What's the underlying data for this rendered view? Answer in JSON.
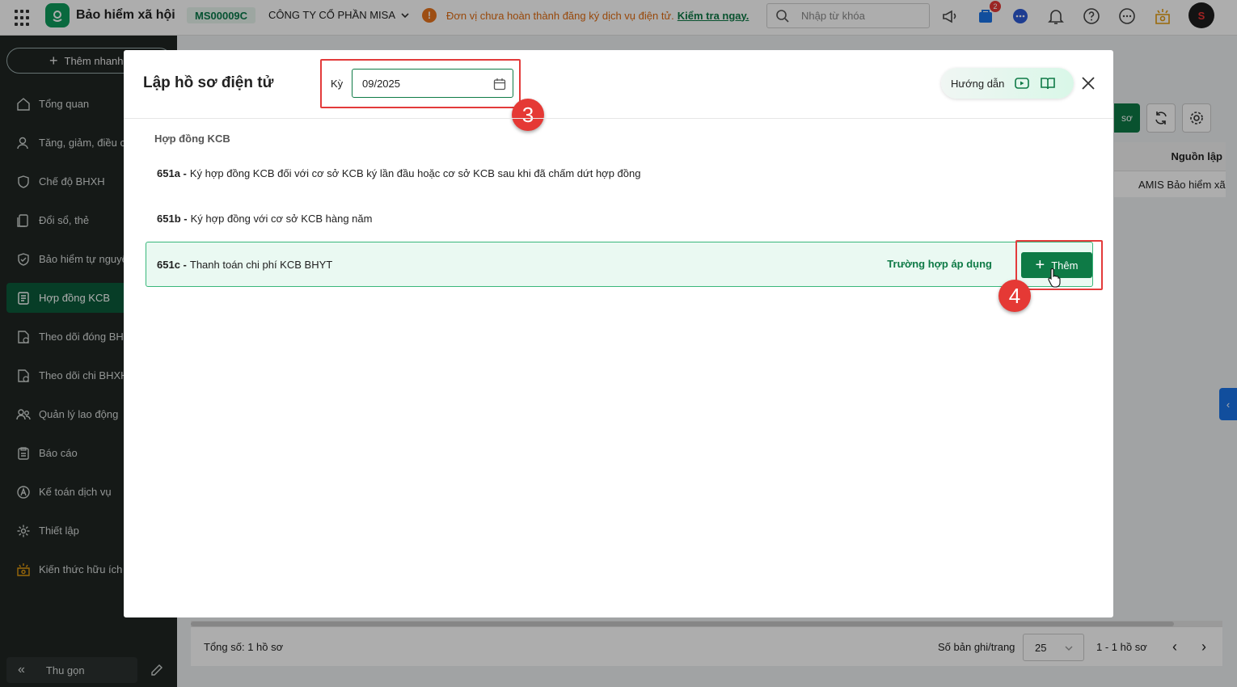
{
  "topbar": {
    "app_name": "Bảo hiểm xã hội",
    "company_code": "MS00009C",
    "company_name": "CÔNG TY CỔ PHẦN MISA",
    "warning_text": "Đơn vị chưa hoàn thành đăng ký dịch vụ điện tử.",
    "warning_link": "Kiểm tra ngay.",
    "search_placeholder": "Nhập từ khóa",
    "cart_badge": "2",
    "icons": [
      "apps-grid-icon",
      "app-logo-icon",
      "megaphone-icon",
      "cart-icon",
      "chat-icon",
      "bell-icon",
      "help-icon",
      "more-icon",
      "knowledge-icon",
      "avatar"
    ]
  },
  "sidebar": {
    "quick_add": "Thêm nhanh",
    "items": [
      {
        "label": "Tổng quan",
        "icon": "home-icon"
      },
      {
        "label": "Tăng, giảm, điều chỉnh",
        "icon": "user-icon"
      },
      {
        "label": "Chế độ BHXH",
        "icon": "shield-icon"
      },
      {
        "label": "Đổi sổ, thẻ",
        "icon": "card-icon"
      },
      {
        "label": "Bảo hiểm tự nguyện",
        "icon": "shield-icon"
      },
      {
        "label": "Hợp đồng KCB",
        "icon": "contract-icon",
        "active": true
      },
      {
        "label": "Theo dõi đóng BHXH",
        "icon": "doc-icon"
      },
      {
        "label": "Theo dõi chi BHXH",
        "icon": "doc-icon"
      },
      {
        "label": "Quản lý lao động",
        "icon": "users-icon"
      },
      {
        "label": "Báo cáo",
        "icon": "report-icon"
      },
      {
        "label": "Kế toán dịch vụ",
        "icon": "accounting-icon"
      },
      {
        "label": "Thiết lập",
        "icon": "gear-icon"
      },
      {
        "label": "Kiến thức hữu ích",
        "icon": "knowledge-icon"
      }
    ],
    "collapse_label": "Thu gọn"
  },
  "background": {
    "green_button_label": "sơ",
    "column_header": "Nguồn lập",
    "cell_value": "AMIS Bảo hiểm xã",
    "total_label": "Tổng số: 1 hồ sơ",
    "per_page_label": "Số bản ghi/trang",
    "per_page_value": "25",
    "range_label": "1 - 1 hồ sơ"
  },
  "modal": {
    "title": "Lập hồ sơ điện tử",
    "period_label": "Kỳ",
    "period_value": "09/2025",
    "guide_label": "Hướng dẫn",
    "section_title": "Hợp đồng KCB",
    "rows": [
      {
        "code": "651a -",
        "text": "Ký hợp đồng KCB đối với cơ sở KCB ký lần đầu hoặc cơ sở KCB sau khi đã chấm dứt hợp đồng"
      },
      {
        "code": "651b -",
        "text": "Ký hợp đồng với cơ sở KCB hàng năm"
      },
      {
        "code": "651c -",
        "text": "Thanh toán chi phí KCB BHYT",
        "apply_label": "Trường hợp áp dụng",
        "add_label": "Thêm"
      }
    ],
    "step_3": "3",
    "step_4": "4"
  },
  "colors": {
    "primary": "#0e7a46",
    "highlight": "#e33b3b",
    "sidebar": "#1f2523"
  }
}
